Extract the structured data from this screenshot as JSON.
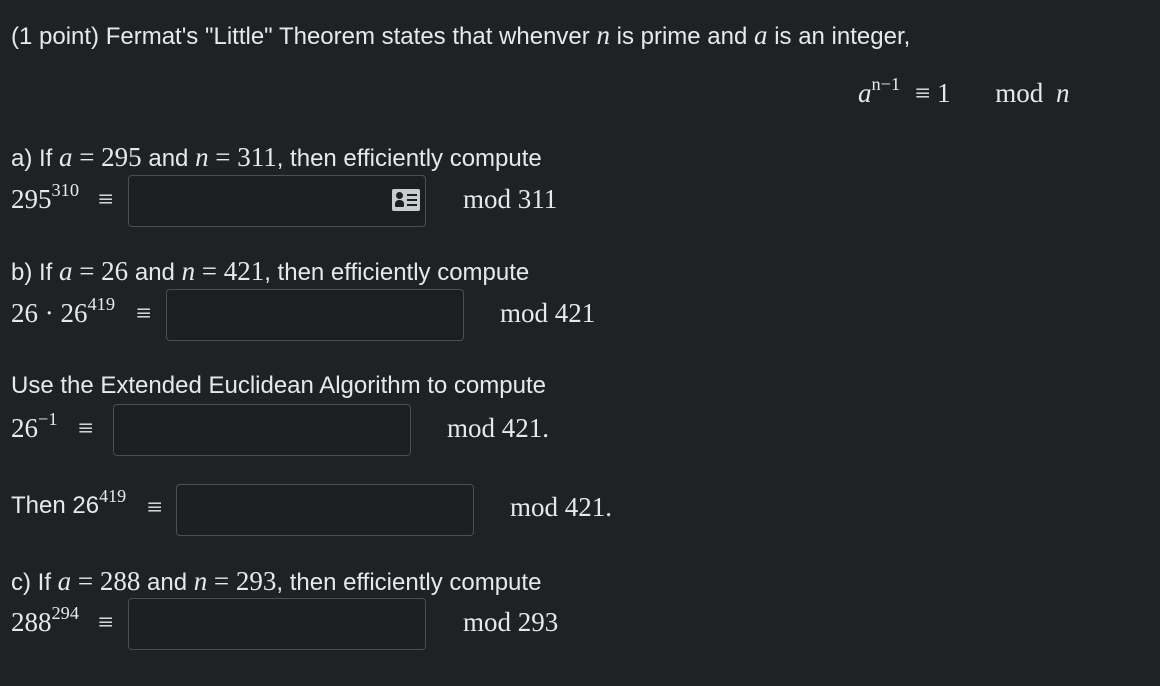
{
  "intro": {
    "prefix": "(1 point) Fermat's \"Little\" Theorem states that whenver",
    "n": "n",
    "mid": "is prime and",
    "a": "a",
    "suffix": "is an integer,"
  },
  "theorem": {
    "a": "a",
    "exp": "n−1",
    "rel": "≡ 1",
    "mod": "mod",
    "n": "n"
  },
  "part_a": {
    "lead": "a) If",
    "a": "a",
    "eq1": "= 295",
    "and": "and",
    "n": "n",
    "eq2": "= 311",
    "tail": ", then efficiently compute",
    "base": "295",
    "exp": "310",
    "equiv": "≡",
    "mod": "mod  311",
    "value": ""
  },
  "part_b": {
    "lead": "b) If",
    "a": "a",
    "eq1": "= 26",
    "and": "and",
    "n": "n",
    "eq2": "= 421",
    "tail": ", then efficiently compute",
    "base": "26 · 26",
    "exp": "419",
    "equiv": "≡",
    "mod": "mod  421",
    "value": ""
  },
  "euclid": {
    "text": "Use the Extended Euclidean Algorithm to compute",
    "base": "26",
    "exp": "−1",
    "equiv": "≡",
    "mod": "mod  421.",
    "value": ""
  },
  "then": {
    "lead": "Then 26",
    "exp": "419",
    "equiv": "≡",
    "mod": "mod  421.",
    "value": ""
  },
  "part_c": {
    "lead": "c) If",
    "a": "a",
    "eq1": "= 288",
    "and": "and",
    "n": "n",
    "eq2": "= 293",
    "tail": ", then efficiently compute",
    "base": "288",
    "exp": "294",
    "equiv": "≡",
    "mod": "mod  293",
    "value": ""
  },
  "icons": {
    "answer_a_helper": "contact-card-icon"
  }
}
